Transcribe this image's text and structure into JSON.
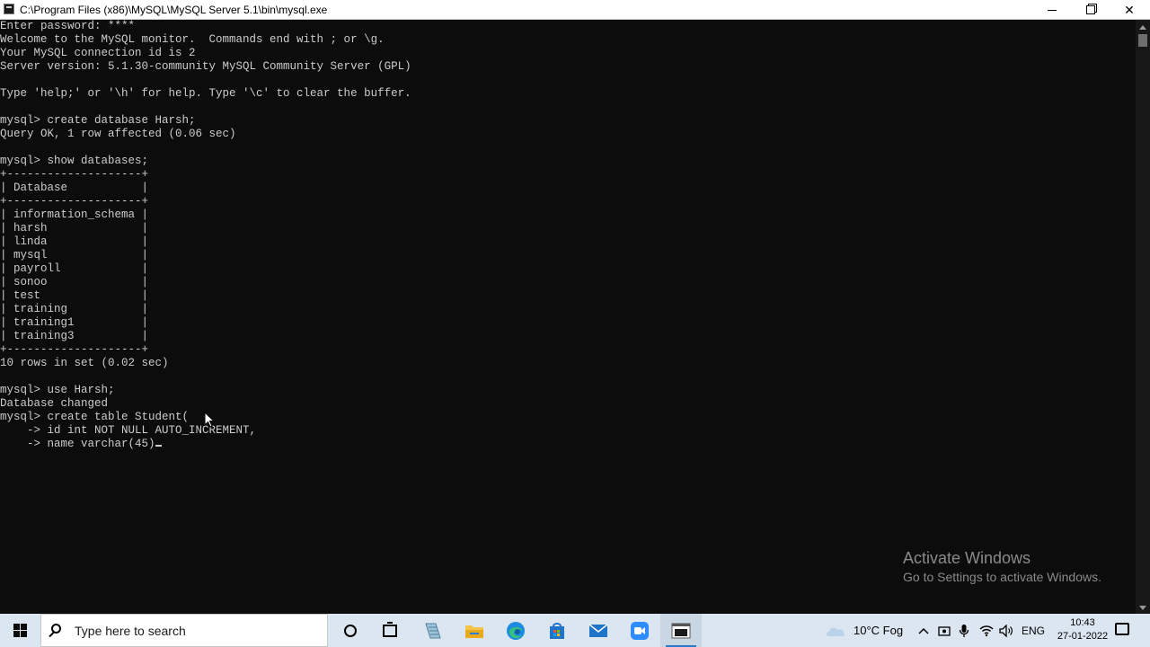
{
  "window": {
    "title": "C:\\Program Files (x86)\\MySQL\\MySQL Server 5.1\\bin\\mysql.exe"
  },
  "console": {
    "lines_before_cursor": "Enter password: ****\nWelcome to the MySQL monitor.  Commands end with ; or \\g.\nYour MySQL connection id is 2\nServer version: 5.1.30-community MySQL Community Server (GPL)\n\nType 'help;' or '\\h' for help. Type '\\c' to clear the buffer.\n\nmysql> create database Harsh;\nQuery OK, 1 row affected (0.06 sec)\n\nmysql> show databases;\n+--------------------+\n| Database           |\n+--------------------+\n| information_schema |\n| harsh              |\n| linda              |\n| mysql              |\n| payroll            |\n| sonoo              |\n| test               |\n| training           |\n| training1          |\n| training3          |\n+--------------------+\n10 rows in set (0.02 sec)\n\nmysql> use Harsh;\nDatabase changed\nmysql> create table Student(\n    -> id int NOT NULL AUTO_INCREMENT,\n    -> name varchar(45)"
  },
  "watermark": {
    "line1": "Activate Windows",
    "line2": "Go to Settings to activate Windows."
  },
  "taskbar": {
    "search_placeholder": "Type here to search",
    "pinned_apps": [
      "cortana",
      "task-view",
      "app",
      "file-explorer",
      "edge",
      "store",
      "mail",
      "zoom",
      "mysql-console"
    ],
    "weather": "10°C  Fog",
    "language": "ENG",
    "time": "10:43",
    "date": "27-01-2022"
  }
}
